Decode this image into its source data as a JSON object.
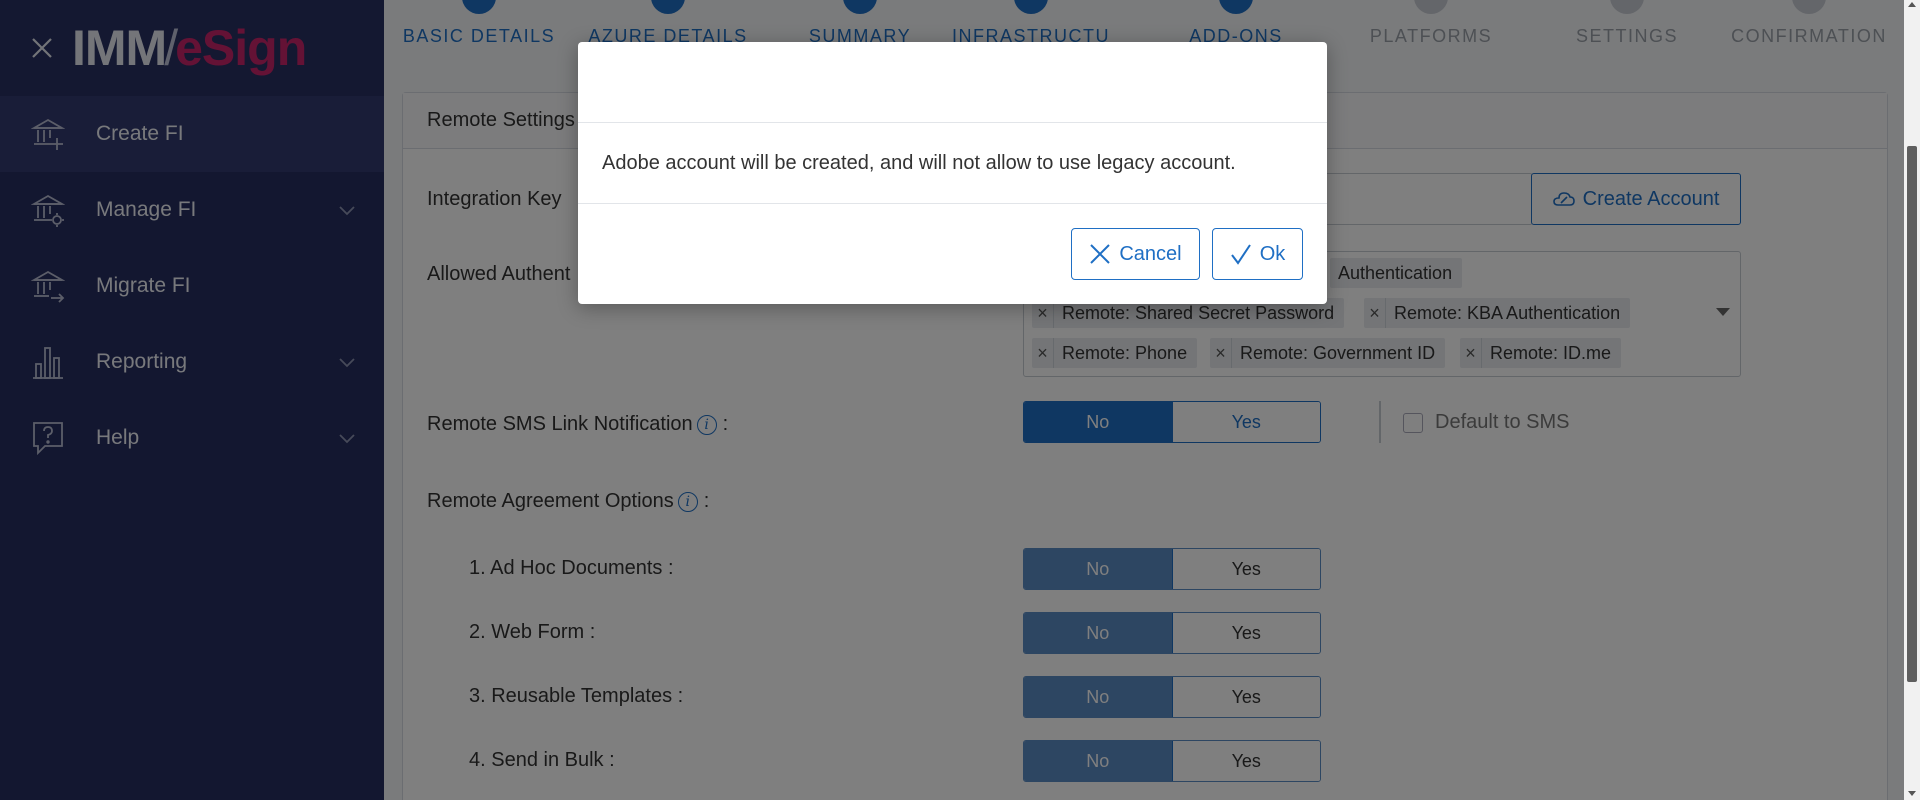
{
  "app": {
    "logo_part1": "IMM",
    "logo_part2": "/",
    "logo_part3": "eSign"
  },
  "sidebar": {
    "items": [
      {
        "label": "Create FI",
        "icon": "bank-plus-icon",
        "active": true,
        "expandable": false
      },
      {
        "label": "Manage FI",
        "icon": "bank-gear-icon",
        "active": false,
        "expandable": true
      },
      {
        "label": "Migrate FI",
        "icon": "bank-arrow-icon",
        "active": false,
        "expandable": false
      },
      {
        "label": "Reporting",
        "icon": "bar-chart-icon",
        "active": false,
        "expandable": true
      },
      {
        "label": "Help",
        "icon": "help-bubble-icon",
        "active": false,
        "expandable": true
      }
    ]
  },
  "steps": [
    {
      "label": "BASIC DETAILS",
      "state": "done"
    },
    {
      "label": "AZURE DETAILS",
      "state": "done"
    },
    {
      "label": "SUMMARY",
      "state": "done"
    },
    {
      "label": "INFRASTRUCTU",
      "state": "done"
    },
    {
      "label": "ADD-ONS",
      "state": "done"
    },
    {
      "label": "PLATFORMS",
      "state": "todo"
    },
    {
      "label": "SETTINGS",
      "state": "todo"
    },
    {
      "label": "CONFIRMATION",
      "state": "todo"
    }
  ],
  "section": {
    "title": "Remote Settings",
    "integration_key_label": "Integration Key",
    "create_account_label": "Create Account",
    "allowed_auth_label": "Allowed Authent",
    "auth_chips": [
      "Authentication",
      "Remote: Shared Secret Password",
      "Remote: KBA Authentication",
      "Remote: Phone",
      "Remote: Government ID",
      "Remote: ID.me"
    ],
    "sms_label": "Remote SMS Link Notification",
    "sms_colon": ":",
    "default_sms_label": "Default to SMS",
    "agreement_label": "Remote Agreement Options",
    "agreement_colon": ":",
    "no_label": "No",
    "yes_label": "Yes",
    "options": [
      {
        "label": "1. Ad Hoc Documents :"
      },
      {
        "label": "2. Web Form :"
      },
      {
        "label": "3. Reusable Templates :"
      },
      {
        "label": "4. Send in Bulk :"
      }
    ]
  },
  "modal": {
    "message": "Adobe account will be created, and will not allow to use legacy account.",
    "cancel_label": "Cancel",
    "ok_label": "Ok"
  },
  "colors": {
    "sidebar_bg": "#262e61",
    "accent": "#1f6fc4",
    "brand_pink": "#c8256b"
  }
}
